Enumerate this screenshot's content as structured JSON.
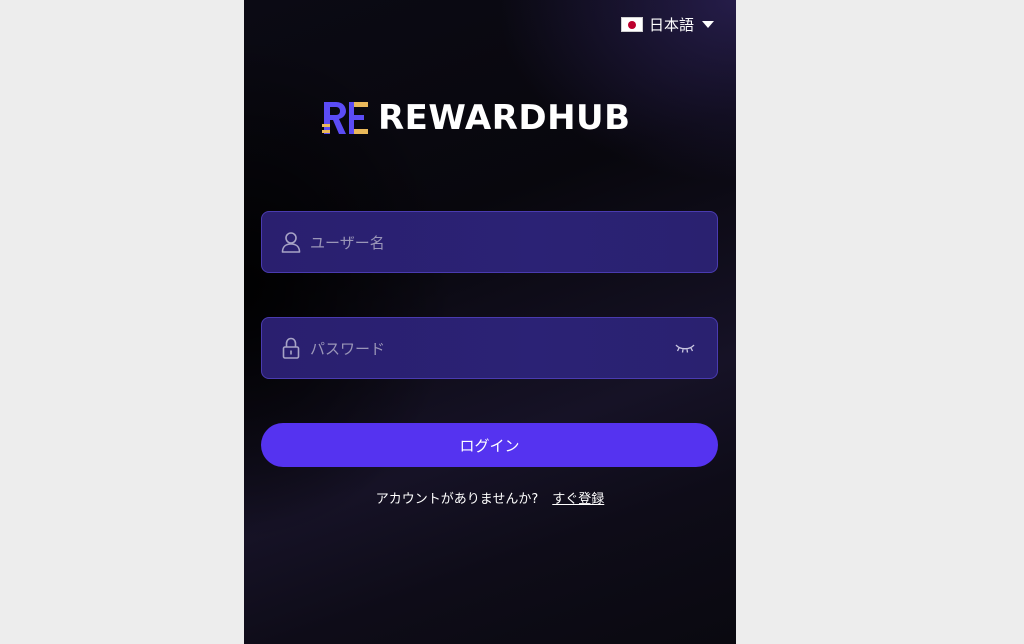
{
  "language": {
    "label": "日本語",
    "flag_icon": "japan-flag-icon"
  },
  "logo": {
    "text": "REWARDHUB",
    "mark": "RE",
    "colors": {
      "blue": "#5b4cf5",
      "gold": "#e9b85a"
    }
  },
  "form": {
    "username_placeholder": "ユーザー名",
    "password_placeholder": "パスワード",
    "login_label": "ログイン"
  },
  "signup": {
    "prompt": "アカウントがありませんか?",
    "link": "すぐ登録"
  },
  "colors": {
    "accent": "#5533f0",
    "field_bg": "#2a1f6f",
    "page_bg": "#ededed"
  }
}
